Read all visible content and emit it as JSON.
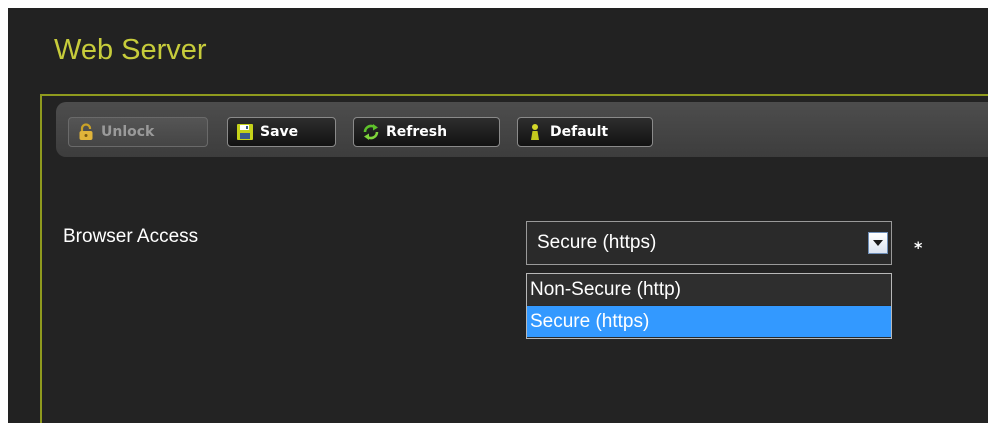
{
  "page": {
    "title": "Web Server"
  },
  "toolbar": {
    "unlock_label": "Unlock",
    "save_label": "Save",
    "refresh_label": "Refresh",
    "default_label": "Default",
    "unlock_icon": "padlock-icon",
    "save_icon": "floppy-disk-icon",
    "refresh_icon": "refresh-arrows-icon",
    "default_icon": "figure-icon"
  },
  "form": {
    "browser_access": {
      "label": "Browser Access",
      "selected_value": "Secure (https)",
      "required_marker": "*",
      "options": [
        "Non-Secure (http)",
        "Secure (https)"
      ],
      "highlighted_option_index": 1
    }
  },
  "colors": {
    "background": "#222222",
    "title_accent": "#c7cc3b",
    "panel_border": "#8f9a1e",
    "selection_highlight": "#3399ff"
  }
}
